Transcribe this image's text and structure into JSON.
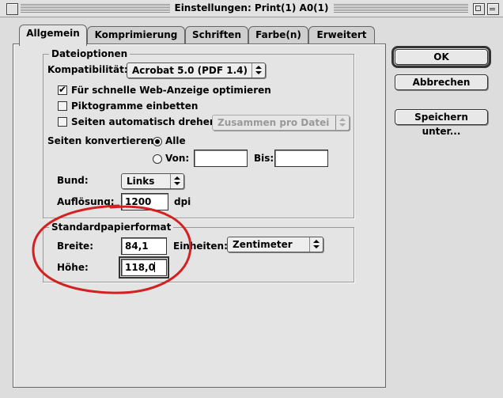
{
  "window": {
    "title": "Einstellungen: Print(1) A0(1)"
  },
  "tabs": [
    {
      "label": "Allgemein",
      "active": true
    },
    {
      "label": "Komprimierung",
      "active": false
    },
    {
      "label": "Schriften",
      "active": false
    },
    {
      "label": "Farbe(n)",
      "active": false
    },
    {
      "label": "Erweitert",
      "active": false
    }
  ],
  "dateioptionen": {
    "title": "Dateioptionen",
    "kompatibilitaet_label": "Kompatibilität:",
    "kompatibilitaet_value": "Acrobat 5.0 (PDF 1.4)",
    "web_optimieren": {
      "label": "Für schnelle Web-Anzeige optimieren",
      "checked": true
    },
    "piktogramme": {
      "label": "Piktogramme einbetten",
      "checked": false
    },
    "auto_drehen": {
      "label": "Seiten automatisch drehen:",
      "checked": false,
      "popup_value": "Zusammen pro Datei"
    },
    "seiten_konvertieren_label": "Seiten konvertieren:",
    "alle_label": "Alle",
    "von_label": "Von:",
    "von_value": "",
    "bis_label": "Bis:",
    "bis_value": "",
    "bund_label": "Bund:",
    "bund_value": "Links",
    "aufloesung_label": "Auflösung:",
    "aufloesung_value": "1200",
    "aufloesung_unit": "dpi"
  },
  "standardpapierformat": {
    "title": "Standardpapierformat",
    "breite_label": "Breite:",
    "breite_value": "84,1",
    "einheiten_label": "Einheiten:",
    "einheiten_value": "Zentimeter",
    "hoehe_label": "Höhe:",
    "hoehe_value": "118,0"
  },
  "buttons": {
    "ok": "OK",
    "abbrechen": "Abbrechen",
    "speichern": "Speichern unter..."
  },
  "colors": {
    "annotation": "#d42020"
  }
}
